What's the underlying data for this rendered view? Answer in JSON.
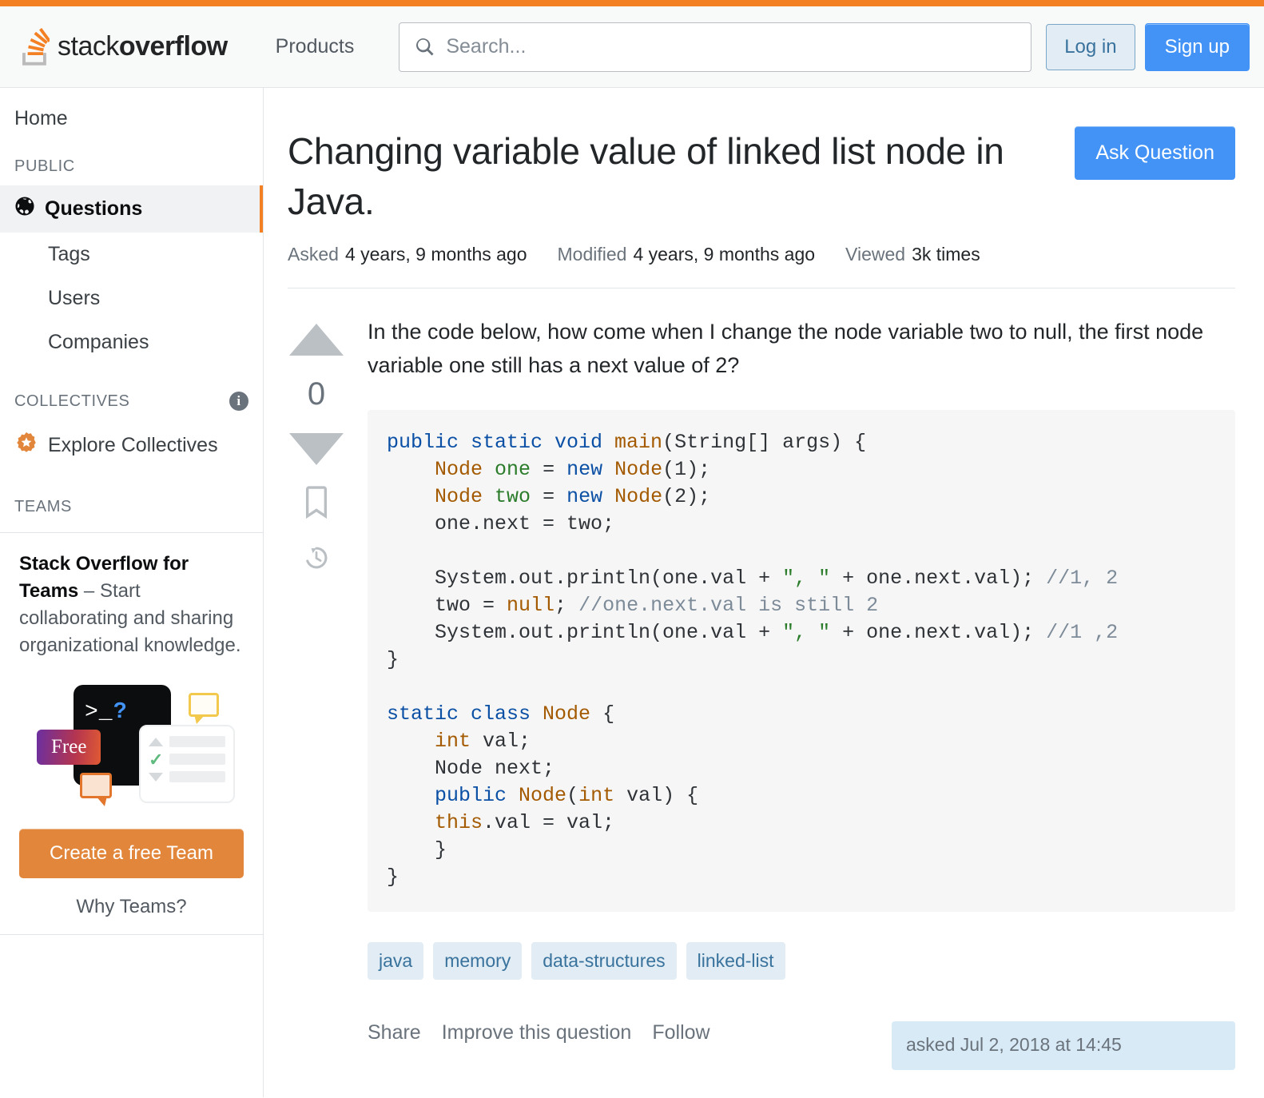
{
  "header": {
    "logo_text_light": "stack",
    "logo_text_bold": "overflow",
    "logo_icon": "stack-overflow-logo-icon",
    "products_label": "Products",
    "search_placeholder": "Search...",
    "search_value": "",
    "search_icon": "search-icon",
    "login_label": "Log in",
    "signup_label": "Sign up",
    "accent_color": "#f48024",
    "primary_button_color": "#4393f7"
  },
  "sidebar": {
    "home_label": "Home",
    "public_section_label": "PUBLIC",
    "collectives_section_label": "COLLECTIVES",
    "teams_section_label": "TEAMS",
    "info_icon": "info-icon",
    "items": [
      {
        "label": "Questions",
        "icon": "globe-icon",
        "active": true
      },
      {
        "label": "Tags",
        "icon": "",
        "active": false
      },
      {
        "label": "Users",
        "icon": "",
        "active": false
      },
      {
        "label": "Companies",
        "icon": "",
        "active": false
      }
    ],
    "collectives": {
      "label": "Explore Collectives",
      "icon": "collectives-star-icon"
    },
    "teams_card": {
      "title": "Stack Overflow for Teams",
      "body": " – Start collaborating and sharing organizational knowledge.",
      "promo": {
        "terminal_glyph": ">_",
        "terminal_question": "?",
        "free_badge": "Free"
      },
      "cta_label": "Create a free Team",
      "why_label": "Why Teams?",
      "cta_color": "#e1863a"
    }
  },
  "question": {
    "title": "Changing variable value of linked list node in Java.",
    "ask_button_label": "Ask Question",
    "meta": {
      "asked_label": "Asked",
      "asked_value": "4 years, 9 months ago",
      "modified_label": "Modified",
      "modified_value": "4 years, 9 months ago",
      "viewed_label": "Viewed",
      "viewed_value": "3k times"
    },
    "votes": {
      "score": "0",
      "upvote_icon": "arrow-up-icon",
      "downvote_icon": "arrow-down-icon",
      "bookmark_icon": "bookmark-icon",
      "history_icon": "history-icon"
    },
    "body_text": "In the code below, how come when I change the node variable two to null, the first node variable one still has a next value of 2?",
    "code_lines": [
      {
        "segments": [
          {
            "t": "public static void ",
            "c": "k"
          },
          {
            "t": "main",
            "c": "t"
          },
          {
            "t": "(String[] args) {",
            "c": ""
          }
        ]
      },
      {
        "segments": [
          {
            "t": "    ",
            "c": ""
          },
          {
            "t": "Node",
            "c": "t"
          },
          {
            "t": " ",
            "c": ""
          },
          {
            "t": "one",
            "c": "v"
          },
          {
            "t": " = ",
            "c": ""
          },
          {
            "t": "new",
            "c": "k"
          },
          {
            "t": " ",
            "c": ""
          },
          {
            "t": "Node",
            "c": "t"
          },
          {
            "t": "(1);",
            "c": ""
          }
        ]
      },
      {
        "segments": [
          {
            "t": "    ",
            "c": ""
          },
          {
            "t": "Node",
            "c": "t"
          },
          {
            "t": " ",
            "c": ""
          },
          {
            "t": "two",
            "c": "v"
          },
          {
            "t": " = ",
            "c": ""
          },
          {
            "t": "new",
            "c": "k"
          },
          {
            "t": " ",
            "c": ""
          },
          {
            "t": "Node",
            "c": "t"
          },
          {
            "t": "(2);",
            "c": ""
          }
        ]
      },
      {
        "segments": [
          {
            "t": "    one.next = two;",
            "c": ""
          }
        ]
      },
      {
        "segments": [
          {
            "t": "",
            "c": ""
          }
        ]
      },
      {
        "segments": [
          {
            "t": "    System.out.println(one.val + ",
            "c": ""
          },
          {
            "t": "\", \"",
            "c": "s"
          },
          {
            "t": " + one.next.val); ",
            "c": ""
          },
          {
            "t": "//1, 2",
            "c": "c"
          }
        ]
      },
      {
        "segments": [
          {
            "t": "    two = ",
            "c": ""
          },
          {
            "t": "null",
            "c": "t"
          },
          {
            "t": "; ",
            "c": ""
          },
          {
            "t": "//one.next.val is still 2",
            "c": "c"
          }
        ]
      },
      {
        "segments": [
          {
            "t": "    System.out.println(one.val + ",
            "c": ""
          },
          {
            "t": "\", \"",
            "c": "s"
          },
          {
            "t": " + one.next.val); ",
            "c": ""
          },
          {
            "t": "//1 ,2",
            "c": "c"
          }
        ]
      },
      {
        "segments": [
          {
            "t": "}",
            "c": ""
          }
        ]
      },
      {
        "segments": [
          {
            "t": "",
            "c": ""
          }
        ]
      },
      {
        "segments": [
          {
            "t": "static class ",
            "c": "k"
          },
          {
            "t": "Node",
            "c": "t"
          },
          {
            "t": " {",
            "c": ""
          }
        ]
      },
      {
        "segments": [
          {
            "t": "    ",
            "c": ""
          },
          {
            "t": "int",
            "c": "t"
          },
          {
            "t": " val;",
            "c": ""
          }
        ]
      },
      {
        "segments": [
          {
            "t": "    Node next;",
            "c": ""
          }
        ]
      },
      {
        "segments": [
          {
            "t": "    ",
            "c": ""
          },
          {
            "t": "public",
            "c": "k"
          },
          {
            "t": " ",
            "c": ""
          },
          {
            "t": "Node",
            "c": "t"
          },
          {
            "t": "(",
            "c": ""
          },
          {
            "t": "int",
            "c": "t"
          },
          {
            "t": " val) {",
            "c": ""
          }
        ]
      },
      {
        "segments": [
          {
            "t": "    ",
            "c": ""
          },
          {
            "t": "this",
            "c": "t"
          },
          {
            "t": ".val = val;",
            "c": ""
          }
        ]
      },
      {
        "segments": [
          {
            "t": "    }",
            "c": ""
          }
        ]
      },
      {
        "segments": [
          {
            "t": "}",
            "c": ""
          }
        ]
      }
    ],
    "tags": [
      "java",
      "memory",
      "data-structures",
      "linked-list"
    ],
    "footer": {
      "share_label": "Share",
      "improve_label": "Improve this question",
      "follow_label": "Follow",
      "asked_stamp": "asked Jul 2, 2018 at 14:45"
    }
  }
}
